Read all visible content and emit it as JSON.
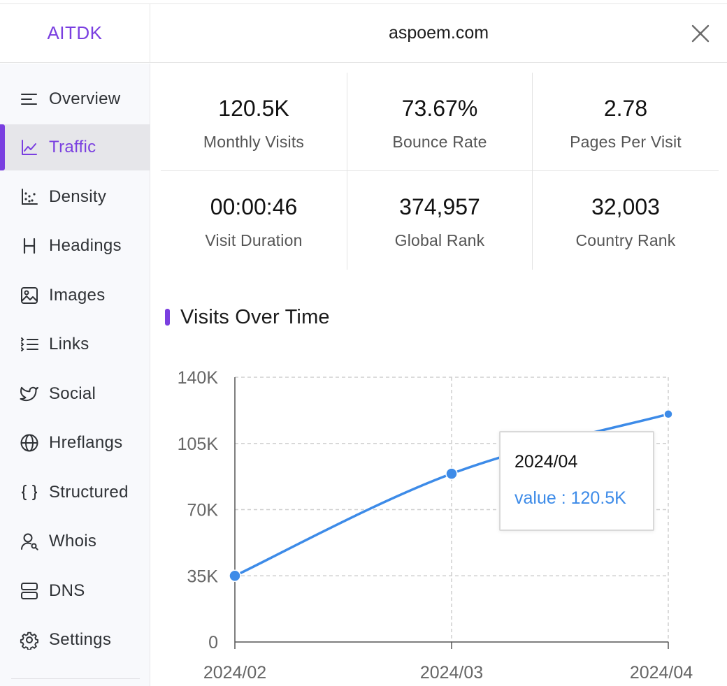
{
  "brand": "AITDK",
  "header": {
    "domain": "aspoem.com"
  },
  "sidebar": {
    "items": [
      {
        "label": "Overview",
        "icon": "list-lines-icon"
      },
      {
        "label": "Traffic",
        "icon": "line-chart-icon",
        "active": true
      },
      {
        "label": "Density",
        "icon": "scatter-dots-icon"
      },
      {
        "label": "Headings",
        "icon": "heading-h-icon"
      },
      {
        "label": "Images",
        "icon": "image-icon"
      },
      {
        "label": "Links",
        "icon": "list-bullets-icon"
      },
      {
        "label": "Social",
        "icon": "twitter-bird-icon"
      },
      {
        "label": "Hreflangs",
        "icon": "globe-icon"
      },
      {
        "label": "Structured",
        "icon": "braces-icon"
      },
      {
        "label": "Whois",
        "icon": "user-search-icon"
      },
      {
        "label": "DNS",
        "icon": "server-icon"
      },
      {
        "label": "Settings",
        "icon": "gear-icon"
      }
    ]
  },
  "stats": [
    {
      "value": "120.5K",
      "label": "Monthly Visits"
    },
    {
      "value": "73.67%",
      "label": "Bounce Rate"
    },
    {
      "value": "2.78",
      "label": "Pages Per Visit"
    },
    {
      "value": "00:00:46",
      "label": "Visit Duration"
    },
    {
      "value": "374,957",
      "label": "Global Rank"
    },
    {
      "value": "32,003",
      "label": "Country Rank"
    }
  ],
  "section": {
    "title": "Visits Over Time"
  },
  "chart_data": {
    "type": "line",
    "categories": [
      "2024/02",
      "2024/03",
      "2024/04"
    ],
    "values": [
      35000,
      89000,
      120500
    ],
    "ylim": [
      0,
      140000
    ],
    "yticks": [
      "0",
      "35K",
      "70K",
      "105K",
      "140K"
    ],
    "grid": true,
    "color": "#3d8be8"
  },
  "tooltip": {
    "date": "2024/04",
    "value_text": "value : 120.5K"
  },
  "colors": {
    "accent": "#7a3fe0",
    "line": "#3d8be8"
  }
}
